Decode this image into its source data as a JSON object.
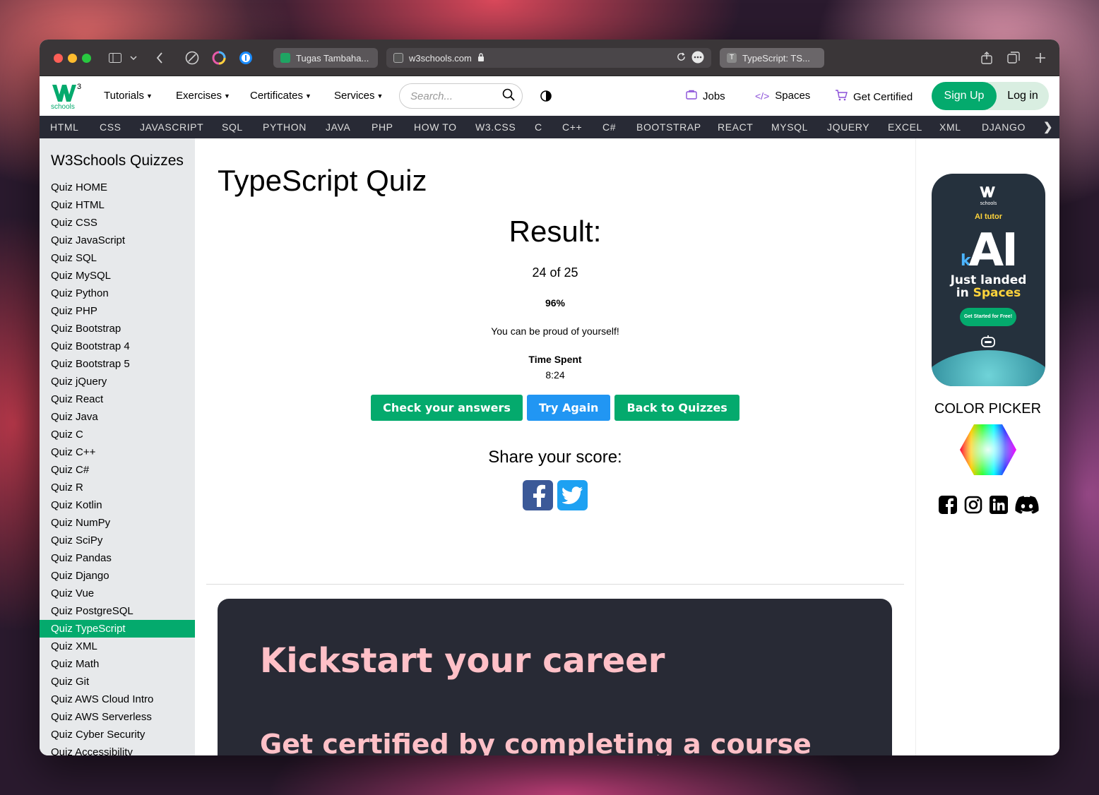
{
  "browser": {
    "tabs": [
      {
        "title": "Tugas Tambaha..."
      },
      {
        "title": "w3schools.com"
      },
      {
        "title": "TypeScript: TS..."
      }
    ]
  },
  "topnav": {
    "logo_sub": "schools",
    "menu": [
      "Tutorials",
      "Exercises",
      "Certificates",
      "Services"
    ],
    "search_placeholder": "Search...",
    "jobs": "Jobs",
    "spaces": "Spaces",
    "get_certified": "Get Certified",
    "signup": "Sign Up",
    "login": "Log in"
  },
  "langbar": [
    "HTML",
    "CSS",
    "JAVASCRIPT",
    "SQL",
    "PYTHON",
    "JAVA",
    "PHP",
    "HOW TO",
    "W3.CSS",
    "C",
    "C++",
    "C#",
    "BOOTSTRAP",
    "REACT",
    "MYSQL",
    "JQUERY",
    "EXCEL",
    "XML",
    "DJANGO"
  ],
  "sidebar": {
    "title": "W3Schools Quizzes",
    "items": [
      "Quiz HOME",
      "Quiz HTML",
      "Quiz CSS",
      "Quiz JavaScript",
      "Quiz SQL",
      "Quiz MySQL",
      "Quiz Python",
      "Quiz PHP",
      "Quiz Bootstrap",
      "Quiz Bootstrap 4",
      "Quiz Bootstrap 5",
      "Quiz jQuery",
      "Quiz React",
      "Quiz Java",
      "Quiz C",
      "Quiz C++",
      "Quiz C#",
      "Quiz R",
      "Quiz Kotlin",
      "Quiz NumPy",
      "Quiz SciPy",
      "Quiz Pandas",
      "Quiz Django",
      "Quiz Vue",
      "Quiz PostgreSQL",
      "Quiz TypeScript",
      "Quiz XML",
      "Quiz Math",
      "Quiz Git",
      "Quiz AWS Cloud Intro",
      "Quiz AWS Serverless",
      "Quiz Cyber Security",
      "Quiz Accessibility"
    ],
    "active": "Quiz TypeScript"
  },
  "main": {
    "title": "TypeScript Quiz",
    "result_heading": "Result:",
    "score": "24 of 25",
    "percent": "96%",
    "message": "You can be proud of yourself!",
    "time_label": "Time Spent",
    "time_value": "8:24",
    "buttons": {
      "check": "Check your answers",
      "retry": "Try Again",
      "back": "Back to Quizzes"
    },
    "share_title": "Share your score:",
    "banner_title": "Kickstart your career",
    "banner_sub": "Get certified by completing a course"
  },
  "right": {
    "ad_logo_sub": "schools",
    "ad_ai_tutor": "AI tutor",
    "ad_kai_k": "k",
    "ad_kai_ai": "AI",
    "ad_just_landed": "Just landed",
    "ad_in": "in ",
    "ad_spaces": "Spaces",
    "ad_cta": "Get Started for Free!",
    "color_picker": "COLOR PICKER"
  },
  "colors": {
    "brand_green": "#04aa6d",
    "blue": "#2196f3",
    "dark": "#282a35",
    "banner_text": "#ffc0c7"
  }
}
